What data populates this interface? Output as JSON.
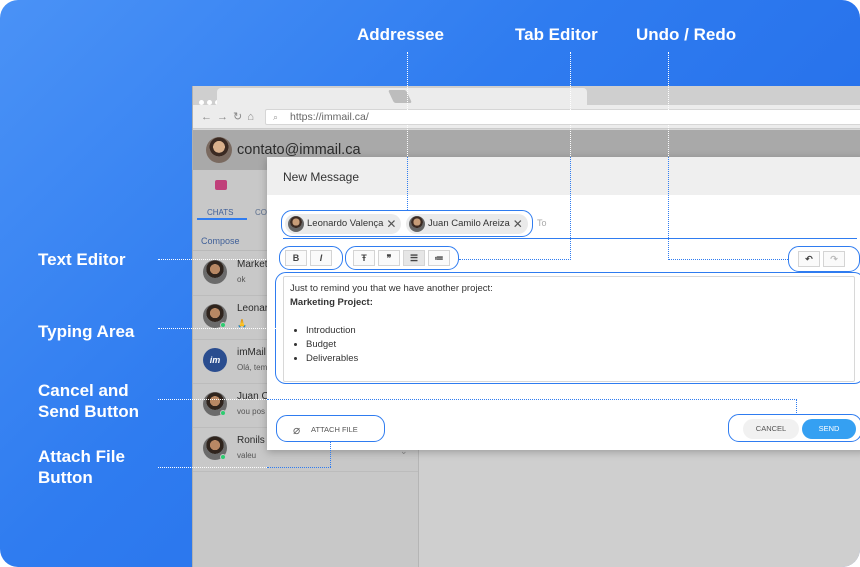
{
  "callouts": {
    "addressee": "Addressee",
    "tab_editor": "Tab Editor",
    "undo_redo": "Undo / Redo",
    "text_editor": "Text Editor",
    "typing_area": "Typing Area",
    "cancel_send_1": "Cancel and",
    "cancel_send_2": "Send Button",
    "attach_1": "Attach File",
    "attach_2": "Button"
  },
  "browser": {
    "url": "https://immail.ca/",
    "tab_close": "×"
  },
  "app": {
    "account_email": "contato@immail.ca",
    "tabs": [
      "CHATS",
      "CO"
    ],
    "compose_label": "Compose",
    "chats": [
      {
        "name": "Market",
        "message": "ok"
      },
      {
        "name": "Leonar",
        "message": "🙏"
      },
      {
        "name": "imMail",
        "message": "Olá, tem"
      },
      {
        "name": "Juan C",
        "message": "vou pos"
      },
      {
        "name": "Ronils",
        "message": "valeu"
      }
    ],
    "im_logo": "im"
  },
  "dialog": {
    "title": "New Message",
    "recipients": [
      {
        "name": "Leonardo Valença"
      },
      {
        "name": "Juan Camilo Areiza"
      }
    ],
    "to_label": "To",
    "toolbar": {
      "bold": "B",
      "italic": "I",
      "heading": "Ŧ",
      "quote": "❞",
      "bullets": "☰",
      "numbered": "≔",
      "undo": "↶",
      "redo": "↷"
    },
    "body": {
      "line1": "Just to remind you that we have another project:",
      "line2": "Marketing Project:",
      "items": [
        "Introduction",
        "Budget",
        "Deliverables"
      ]
    },
    "attach_label": "ATTACH FILE",
    "cancel_label": "CANCEL",
    "send_label": "SEND"
  },
  "colors": {
    "accent": "#2f7cf0",
    "send": "#35a0f2",
    "background_start": "#4a92f6",
    "background_end": "#1f67e6"
  }
}
